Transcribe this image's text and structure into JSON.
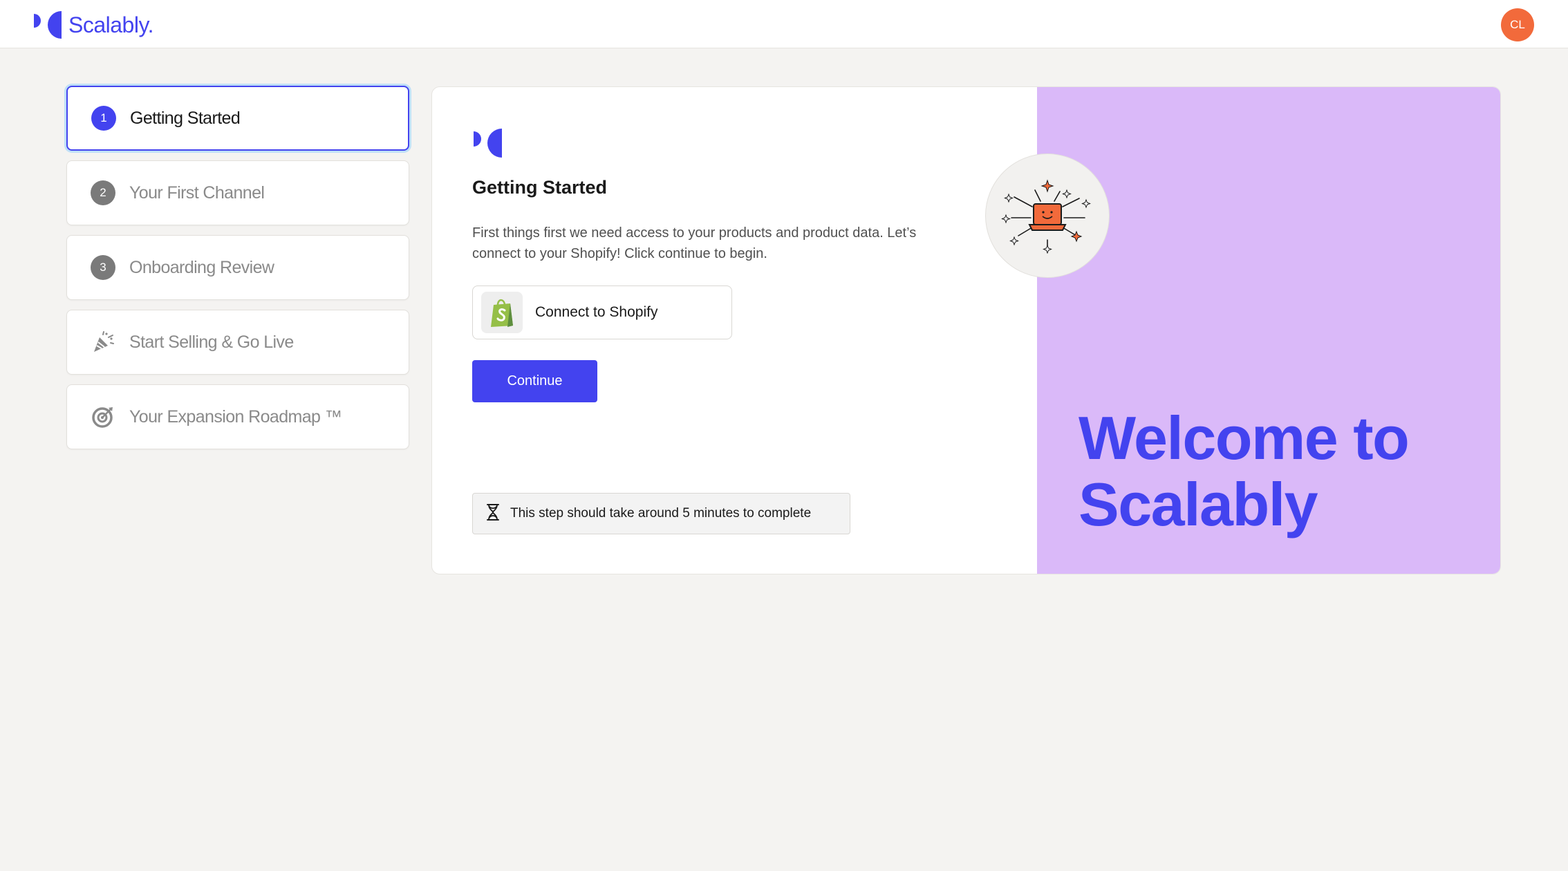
{
  "header": {
    "brand_name": "Scalably.",
    "avatar_initials": "CL"
  },
  "steps": [
    {
      "number": "1",
      "label": "Getting Started",
      "active": true,
      "icon": "number"
    },
    {
      "number": "2",
      "label": "Your First Channel",
      "active": false,
      "icon": "number"
    },
    {
      "number": "3",
      "label": "Onboarding Review",
      "active": false,
      "icon": "number"
    },
    {
      "number": "",
      "label": "Start Selling & Go Live",
      "active": false,
      "icon": "party-popper-icon"
    },
    {
      "number": "",
      "label": "Your Expansion Roadmap ™",
      "active": false,
      "icon": "target-icon"
    }
  ],
  "main": {
    "title": "Getting Started",
    "description": "First things first we need access to your products and product data. Let’s connect to your Shopify! Click continue to begin.",
    "connect_label": "Connect to Shopify",
    "continue_label": "Continue",
    "time_note": "This step should take around 5 minutes to complete",
    "welcome_line1": "Welcome to",
    "welcome_line2": "Scalably"
  },
  "colors": {
    "brand": "#4343ef",
    "panel": "#dab9f9",
    "avatar": "#f26a3b",
    "shopify": "#95bf47"
  }
}
